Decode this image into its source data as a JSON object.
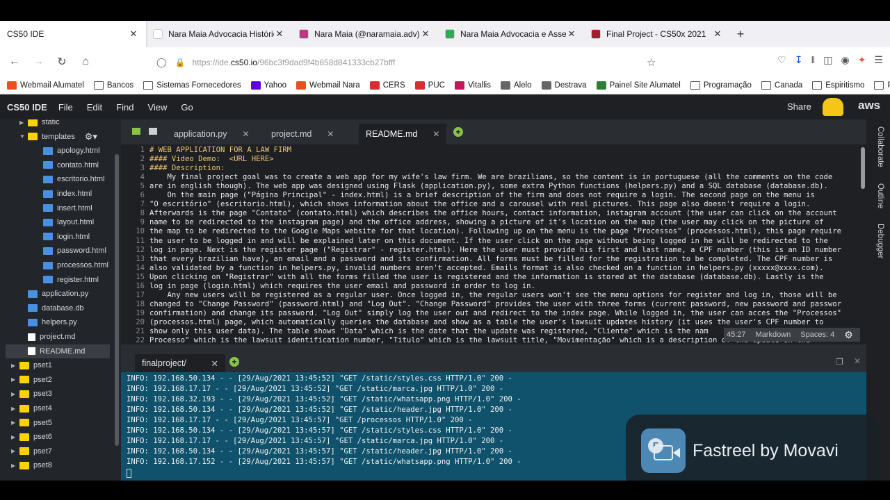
{
  "browser": {
    "tabs": [
      {
        "title": "CS50 IDE",
        "favicon_color": "#ffffff"
      },
      {
        "title": "Nara Maia Advocacia Histórico de P",
        "favicon_color": "#ffffff"
      },
      {
        "title": "Nara Maia (@naramaia.adv) • I",
        "favicon_color": "#c13584"
      },
      {
        "title": "Nara Maia Advocacia e Assesso",
        "favicon_color": "#34a853"
      },
      {
        "title": "Final Project - CS50x 2021",
        "favicon_color": "#a51c30"
      }
    ],
    "url": {
      "prefix": "https://ide.",
      "domain": "cs50.io",
      "path": "/96bc3f9dad9f4b858d841333cb27bfff"
    },
    "bookmarks": [
      {
        "label": "Webmail Alumatel",
        "color": "#e8501e",
        "folder": false
      },
      {
        "label": "Bancos",
        "color": "",
        "folder": true
      },
      {
        "label": "Sistemas Fornecedores",
        "color": "",
        "folder": true
      },
      {
        "label": "Yahoo",
        "color": "#6001d2",
        "folder": false
      },
      {
        "label": "Webmail Nara",
        "color": "#e8501e",
        "folder": false
      },
      {
        "label": "CERS",
        "color": "#d32f2f",
        "folder": false
      },
      {
        "label": "PUC",
        "color": "#d32f2f",
        "folder": false
      },
      {
        "label": "Vitallis",
        "color": "#c2185b",
        "folder": false
      },
      {
        "label": "Alelo",
        "color": "#666666",
        "folder": false
      },
      {
        "label": "Destrava",
        "color": "#666666",
        "folder": false
      },
      {
        "label": "Painel Site Alumatel",
        "color": "#2e7d32",
        "folder": false
      },
      {
        "label": "Programação",
        "color": "",
        "folder": true
      },
      {
        "label": "Canada",
        "color": "",
        "folder": true
      },
      {
        "label": "Espiritismo",
        "color": "",
        "folder": true
      },
      {
        "label": "Pos Nara",
        "color": "",
        "folder": true
      }
    ]
  },
  "ide": {
    "brand": "CS50 IDE",
    "menu": [
      "File",
      "Edit",
      "Find",
      "View",
      "Go"
    ],
    "share": "Share",
    "aws": "aws",
    "tree": [
      {
        "label": "static",
        "type": "folder",
        "depth": 1,
        "arrow": "▶"
      },
      {
        "label": "templates",
        "type": "folder",
        "depth": 1,
        "arrow": "▼"
      },
      {
        "label": "apology.html",
        "type": "html",
        "depth": 2
      },
      {
        "label": "contato.html",
        "type": "html",
        "depth": 2
      },
      {
        "label": "escritorio.html",
        "type": "html",
        "depth": 2
      },
      {
        "label": "index.html",
        "type": "html",
        "depth": 2
      },
      {
        "label": "insert.html",
        "type": "html",
        "depth": 2
      },
      {
        "label": "layout.html",
        "type": "html",
        "depth": 2
      },
      {
        "label": "login.html",
        "type": "html",
        "depth": 2
      },
      {
        "label": "password.html",
        "type": "html",
        "depth": 2
      },
      {
        "label": "processos.html",
        "type": "html",
        "depth": 2
      },
      {
        "label": "register.html",
        "type": "html",
        "depth": 2
      },
      {
        "label": "application.py",
        "type": "py",
        "depth": 1
      },
      {
        "label": "database.db",
        "type": "html",
        "depth": 1
      },
      {
        "label": "helpers.py",
        "type": "py",
        "depth": 1
      },
      {
        "label": "project.md",
        "type": "file",
        "depth": 1
      },
      {
        "label": "README.md",
        "type": "file",
        "depth": 1,
        "selected": true
      },
      {
        "label": "pset1",
        "type": "folder",
        "depth": 0,
        "arrow": "▶"
      },
      {
        "label": "pset2",
        "type": "folder",
        "depth": 0,
        "arrow": "▶"
      },
      {
        "label": "pset3",
        "type": "folder",
        "depth": 0,
        "arrow": "▶"
      },
      {
        "label": "pset4",
        "type": "folder",
        "depth": 0,
        "arrow": "▶"
      },
      {
        "label": "pset5",
        "type": "folder",
        "depth": 0,
        "arrow": "▶"
      },
      {
        "label": "pset6",
        "type": "folder",
        "depth": 0,
        "arrow": "▶"
      },
      {
        "label": "pset7",
        "type": "folder",
        "depth": 0,
        "arrow": "▶"
      },
      {
        "label": "pset8",
        "type": "folder",
        "depth": 0,
        "arrow": "▶"
      }
    ],
    "editor_tabs": [
      {
        "label": "application.py",
        "active": false
      },
      {
        "label": "project.md",
        "active": false
      },
      {
        "label": "README.md",
        "active": true
      }
    ],
    "code_lines": [
      "# WEB APPLICATION FOR A LAW FIRM",
      "#### Video Demo:  <URL HERE>",
      "#### Description:",
      "    My final project goal was to create a web app for my wife's law firm. We are brazilians, so the content is in portuguese (all the comments on the code",
      "are in english though). The web app was designed using Flask (application.py), some extra Python functions (helpers.py) and a SQL database (database.db).",
      "    On the main page (\"Página Principal\" - index.html) is a brief description of the firm and does not require a login. The second page on the menu is",
      "\"O escritório\" (escritorio.html), which shows information about the office and a carousel with real pictures. This page also doesn't require a login.",
      "Afterwards is the page \"Contato\" (contato.html) which describes the office hours, contact information, instagram account (the user can click on the account",
      "name to be redirected to the instagram page) and the office address, showing a picture of it's location on the map (the user may click on the picture of",
      "the map to be redirected to the Google Maps website for that location). Following up on the menu is the page \"Processos\" (processos.html), this page require",
      "the user to be logged in and will be explained later on this document. If the user click on the page without being logged in he will be redirected to the",
      "log in page. Next is the register page (\"Registrar\" - register.html). Here the user must provide his first and last name, a CPF number (this is an ID number",
      "that every brazilian have), an email and a password and its confirmation. All forms must be filled for the registration to be completed. The CPF number is",
      "also validated by a function in helpers.py, invalid numbers aren't accepted. Emails format is also checked on a function in helpers.py (xxxxx@xxxx.com).",
      "Upon clicking on \"Registrar\" with all the forms filled the user is registered and the information is stored at the database (database.db). Lastly is the",
      "log in page (login.html) which requires the user email and password in order to log in.",
      "    Any new users will be registered as a regular user. Once logged in, the regular users won't see the menu options for register and log in, those will be",
      "changed to \"Change Password\" (password.html) and \"Log Out\". \"Change Password\" provides the user with three forms (current password, new password and passwor",
      "confirmation) and change its password. \"Log Out\" simply log the user out and redirect to the index page. While logged in, the user can acces the \"Processos\"",
      "(processos.html) page, which automatically queries the database and show as a table the user's lawsuit updates history (it uses the user's CPF number to",
      "show only this user data). The table shows \"Data\" which is the date that the update was registered, \"Cliente\" which is the nam",
      "Processo\" which is the lawsuit identification number, \"Titulo\" which is the lawsuit title, \"Movimentação\" which is a description of the update on the"
    ],
    "status": {
      "position": "45:27",
      "mode": "Markdown",
      "spaces": "Spaces: 4"
    },
    "right_panel": [
      "Collaborate",
      "Outline",
      "Debugger"
    ],
    "terminal_tab": "finalproject/",
    "terminal_lines": [
      "INFO: 192.168.50.134 - - [29/Aug/2021 13:45:52] \"GET /static/styles.css HTTP/1.0\" 200 -",
      "INFO: 192.168.17.17 - - [29/Aug/2021 13:45:52] \"GET /static/marca.jpg HTTP/1.0\" 200 -",
      "INFO: 192.168.32.193 - - [29/Aug/2021 13:45:52] \"GET /static/whatsapp.png HTTP/1.0\" 200 -",
      "INFO: 192.168.50.134 - - [29/Aug/2021 13:45:52] \"GET /static/header.jpg HTTP/1.0\" 200 -",
      "INFO: 192.168.17.17 - - [29/Aug/2021 13:45:57] \"GET /processos HTTP/1.0\" 200 -",
      "INFO: 192.168.50.134 - - [29/Aug/2021 13:45:57] \"GET /static/styles.css HTTP/1.0\" 200 -",
      "INFO: 192.168.17.17 - - [29/Aug/2021 13:45:57] \"GET /static/marca.jpg HTTP/1.0\" 200 -",
      "INFO: 192.168.50.134 - - [29/Aug/2021 13:45:57] \"GET /static/header.jpg HTTP/1.0\" 200 -",
      "INFO: 192.168.17.152 - - [29/Aug/2021 13:45:57] \"GET /static/whatsapp.png HTTP/1.0\" 200 -"
    ]
  },
  "watermark": {
    "text": "Fastreel by Movavi",
    "icon_letter": "F"
  }
}
